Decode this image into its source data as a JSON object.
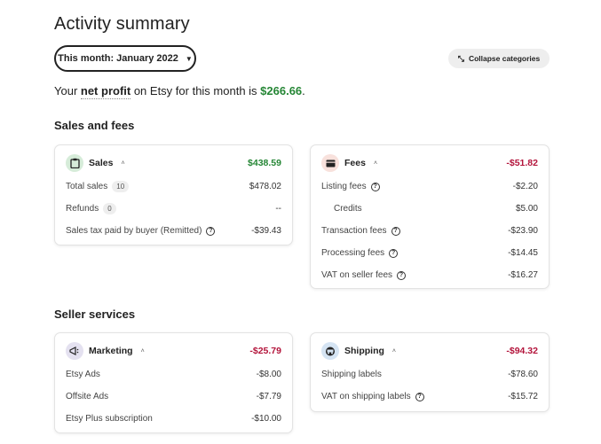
{
  "page": {
    "title": "Activity summary"
  },
  "filter": {
    "month_label": "This month: January 2022",
    "caret": "▼"
  },
  "collapse": {
    "icon": "collapse-arrows-icon",
    "glyph": "⤡",
    "label": "Collapse categories"
  },
  "profit": {
    "prefix": "Your ",
    "strong": "net profit",
    "middle": " on Etsy for this month is ",
    "amount": "$266.66",
    "suffix": "."
  },
  "sections": {
    "sales_fees": "Sales and fees",
    "seller_services": "Seller services"
  },
  "colors": {
    "positive": "#258635",
    "negative": "#b3143b"
  },
  "cards": {
    "sales": {
      "icon": "clipboard-icon",
      "glyph": "📋",
      "label": "Sales",
      "chevron": "˄",
      "total": "$438.59",
      "rows": [
        {
          "label": "Total sales",
          "badge": "10",
          "value": "$478.02"
        },
        {
          "label": "Refunds",
          "badge": "0",
          "value": "--"
        },
        {
          "label": "Sales tax paid by buyer (Remitted)",
          "help": "?",
          "value": "-$39.43"
        }
      ]
    },
    "fees": {
      "icon": "credit-card-icon",
      "glyph": "▬",
      "label": "Fees",
      "chevron": "˄",
      "total": "-$51.82",
      "rows": [
        {
          "label": "Listing fees",
          "help": "?",
          "value": "-$2.20"
        },
        {
          "label": "Credits",
          "value": "$5.00"
        },
        {
          "label": "Transaction fees",
          "help": "?",
          "value": "-$23.90"
        },
        {
          "label": "Processing fees",
          "help": "?",
          "value": "-$14.45"
        },
        {
          "label": "VAT on seller fees",
          "help": "?",
          "value": "-$16.27"
        }
      ]
    },
    "marketing": {
      "icon": "megaphone-icon",
      "glyph": "◁:",
      "label": "Marketing",
      "chevron": "˄",
      "total": "-$25.79",
      "rows": [
        {
          "label": "Etsy Ads",
          "value": "-$8.00"
        },
        {
          "label": "Offsite Ads",
          "value": "-$7.79"
        },
        {
          "label": "Etsy Plus subscription",
          "value": "-$10.00"
        }
      ]
    },
    "shipping": {
      "icon": "shipping-truck-icon",
      "glyph": "⛟",
      "label": "Shipping",
      "chevron": "˄",
      "total": "-$94.32",
      "rows": [
        {
          "label": "Shipping labels",
          "value": "-$78.60"
        },
        {
          "label": "VAT on shipping labels",
          "help": "?",
          "value": "-$15.72"
        }
      ]
    }
  }
}
